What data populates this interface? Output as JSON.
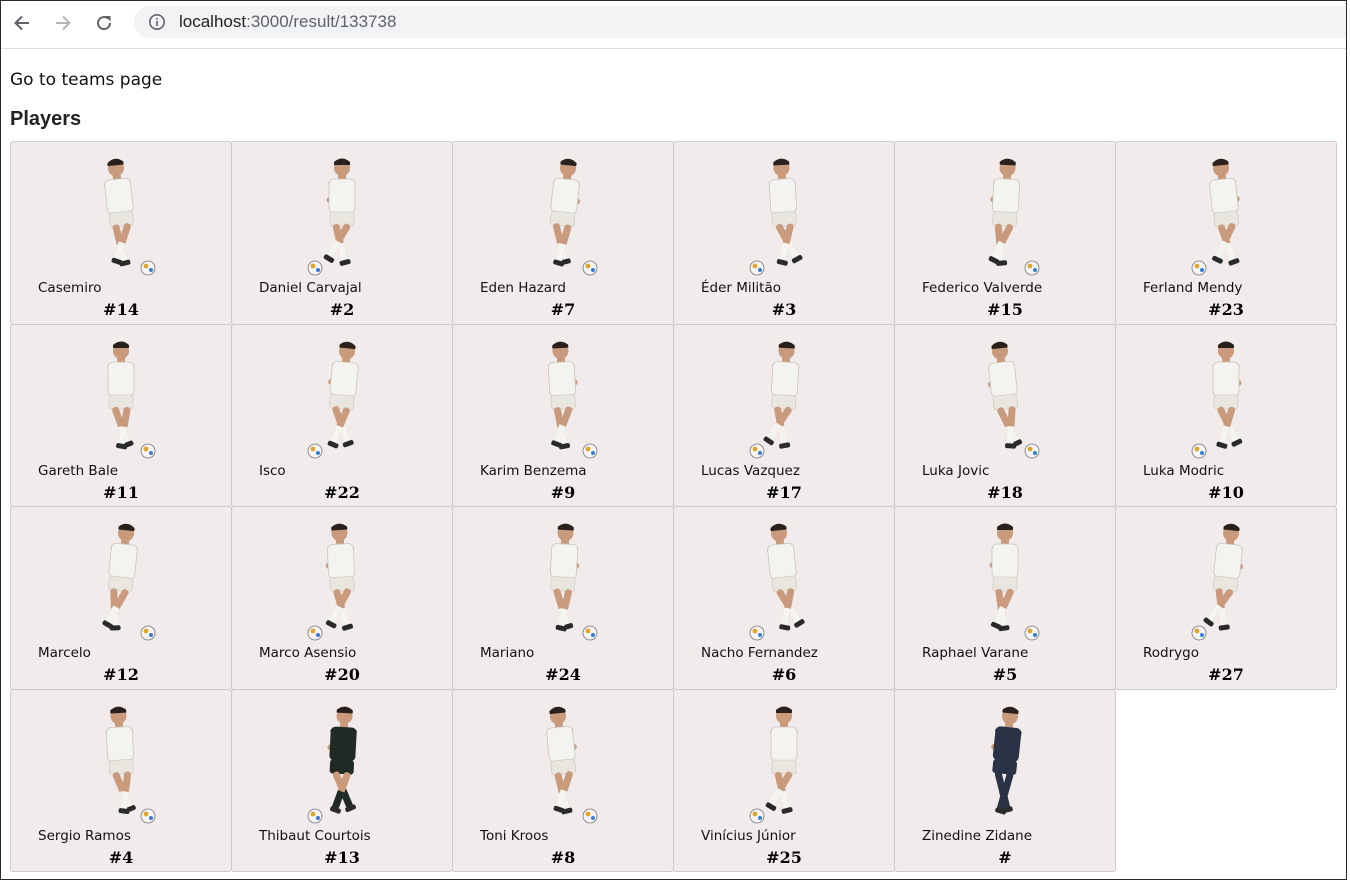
{
  "browser": {
    "url_host": "localhost",
    "url_rest": ":3000/result/133738",
    "back_icon": "arrow-left-icon",
    "forward_icon": "arrow-right-icon",
    "reload_icon": "reload-icon",
    "info_icon": "info-icon"
  },
  "page": {
    "teams_link": "Go to teams page",
    "heading": "Players"
  },
  "colors": {
    "card_bg": "#f2ebeb",
    "home_kit": "#f3f3ef",
    "gk_kit": "#1f2a24",
    "suit": "#2a3346",
    "skin": "#c99a7c"
  },
  "players": [
    {
      "name": "Casemiro",
      "number": "#14",
      "kit": "home"
    },
    {
      "name": "Daniel Carvajal",
      "number": "#2",
      "kit": "home"
    },
    {
      "name": "Eden Hazard",
      "number": "#7",
      "kit": "home"
    },
    {
      "name": "Éder Militão",
      "number": "#3",
      "kit": "home"
    },
    {
      "name": "Federico Valverde",
      "number": "#15",
      "kit": "home"
    },
    {
      "name": "Ferland Mendy",
      "number": "#23",
      "kit": "home"
    },
    {
      "name": "Gareth Bale",
      "number": "#11",
      "kit": "home"
    },
    {
      "name": "Isco",
      "number": "#22",
      "kit": "home"
    },
    {
      "name": "Karim Benzema",
      "number": "#9",
      "kit": "home"
    },
    {
      "name": "Lucas Vazquez",
      "number": "#17",
      "kit": "home"
    },
    {
      "name": "Luka Jovic",
      "number": "#18",
      "kit": "home"
    },
    {
      "name": "Luka Modric",
      "number": "#10",
      "kit": "home"
    },
    {
      "name": "Marcelo",
      "number": "#12",
      "kit": "home"
    },
    {
      "name": "Marco Asensio",
      "number": "#20",
      "kit": "home"
    },
    {
      "name": "Mariano",
      "number": "#24",
      "kit": "home"
    },
    {
      "name": "Nacho Fernandez",
      "number": "#6",
      "kit": "home"
    },
    {
      "name": "Raphael Varane",
      "number": "#5",
      "kit": "home"
    },
    {
      "name": "Rodrygo",
      "number": "#27",
      "kit": "home"
    },
    {
      "name": "Sergio Ramos",
      "number": "#4",
      "kit": "home"
    },
    {
      "name": "Thibaut Courtois",
      "number": "#13",
      "kit": "goalkeeper"
    },
    {
      "name": "Toni Kroos",
      "number": "#8",
      "kit": "home"
    },
    {
      "name": "Vinícius Júnior",
      "number": "#25",
      "kit": "home"
    },
    {
      "name": "Zinedine Zidane",
      "number": "#",
      "kit": "suit"
    }
  ]
}
